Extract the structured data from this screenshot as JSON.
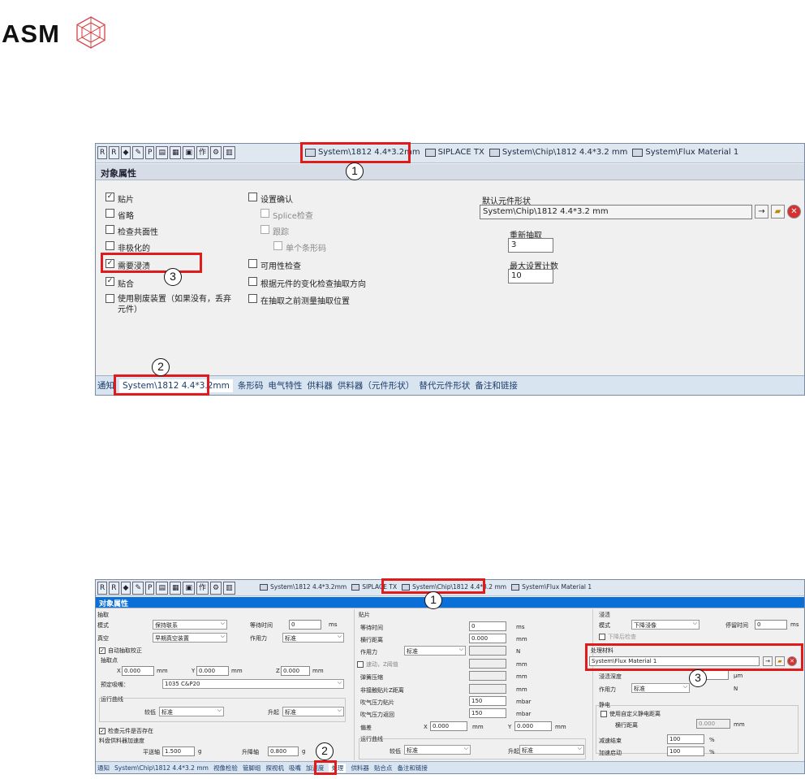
{
  "logo": {
    "text": "ASM"
  },
  "s1": {
    "toolbar_icons": [
      "R",
      "R",
      "",
      "",
      "P",
      "",
      "",
      "",
      "作",
      "",
      ""
    ],
    "tabs": [
      "System\\1812 4.4*3.2mm",
      "SIPLACE TX",
      "System\\Chip\\1812 4.4*3.2 mm",
      "System\\Flux Material 1"
    ],
    "header": "对象属性",
    "col1": [
      "贴片",
      "省略",
      "检查共面性",
      "非极化的",
      "需要浸渍",
      "贴合",
      "使用剔废装置（如果没有，丢弃元件）"
    ],
    "col1_checked": [
      true,
      false,
      false,
      false,
      true,
      true,
      false
    ],
    "col2": [
      "设置确认",
      "Splice检查",
      "跟踪",
      "单个条形码",
      "可用性检查",
      "根据元件的变化检查抽取方向",
      "在抽取之前测量抽取位置"
    ],
    "default_shape_label": "默认元件形状",
    "default_shape_value": "System\\Chip\\1812 4.4*3.2 mm",
    "repick_label": "重新抽取",
    "repick_value": "3",
    "max_count_label": "最大设置计数",
    "max_count_value": "10",
    "bottom_tabs": [
      "通知",
      "System\\1812 4.4*3.2mm",
      "条形码",
      "电气特性",
      "供料器",
      "供料器（元件形状）",
      "替代元件形状",
      "备注和链接"
    ]
  },
  "s2": {
    "toolbar_icons": [
      "R",
      "R",
      "",
      "",
      "P",
      "",
      "",
      "",
      "作",
      "",
      ""
    ],
    "tabs": [
      "System\\1812 4.4*3.2mm",
      "SIPLACE TX",
      "System\\Chip\\1812 4.4*3.2 mm",
      "System\\Flux Material 1"
    ],
    "header": "对象属性",
    "pick": {
      "title": "抽取",
      "mode_label": "模式",
      "mode_value": "保持联系",
      "wait_label": "等待时间",
      "wait_value": "0",
      "wait_unit": "ms",
      "vacuum_label": "真空",
      "vacuum_value": "早期真空装置",
      "force_label": "作用力",
      "force_value": "标准",
      "auto_label": "自动抽取校正",
      "point_label": "抽取点",
      "x_label": "X",
      "x_value": "0.000",
      "y_label": "Y",
      "y_value": "0.000",
      "z_label": "Z",
      "z_value": "0.000",
      "mm": "mm",
      "nozzle_label": "预定吸嘴：",
      "nozzle_value": "1035 C&P20",
      "curve_label": "运行曲线",
      "lower_label": "较低",
      "lower_value": "标准",
      "raise_label": "升起",
      "raise_value": "标准",
      "check_label": "检查元件是否存在",
      "accel_label": "料盘供料器加速度",
      "flat_label": "平送轴",
      "flat_value": "1.500",
      "g": "g",
      "lift_label": "升降轴",
      "lift_value": "0.800"
    },
    "place": {
      "title": "贴片",
      "wait_label": "等待时间",
      "wait_value": "0",
      "wait_unit": "ms",
      "dist_label": "横行距离",
      "dist_value": "0.000",
      "mm": "mm",
      "force_label": "作用力",
      "force_value": "标准",
      "n": "N",
      "speed_label": "速动，Z阈值",
      "spring_label": "弹簧压缩",
      "z_label": "非接触贴片Z距离",
      "blow1_label": "吹气压力贴片",
      "blow1_value": "150",
      "mbar": "mbar",
      "blow2_label": "吹气压力返回",
      "blow2_value": "150",
      "offset_label": "偏差",
      "x_label": "X",
      "x_value": "0.000",
      "y_label": "Y",
      "y_value": "0.000",
      "curve_label": "运行曲线",
      "lower_label": "较低",
      "lower_value": "标准",
      "raise_label": "升起",
      "raise_value": "标准"
    },
    "dip": {
      "title": "浸渍",
      "mode_label": "模式",
      "mode_value": "下降浸像",
      "dwell_label": "停留时间",
      "dwell_value": "0",
      "ms": "ms",
      "check_label": "下降后检查",
      "mat_label": "处理材料",
      "mat_value": "System\\Flux Material 1",
      "depth_label": "浸渍深度",
      "um": "μm",
      "force_label": "作用力",
      "force_value": "标准",
      "n": "N"
    },
    "static": {
      "title": "静电",
      "custom_label": "使用自定义静电距离",
      "dist_label": "横行距离",
      "dist_value": "0.000",
      "mm": "mm",
      "dec_label": "减速结束",
      "dec_value": "100",
      "pct": "%",
      "acc_label": "加速启动",
      "acc_value": "100"
    },
    "bottom_tabs": [
      "通知",
      "System\\Chip\\1812 4.4*3.2 mm",
      "视像检验",
      "管脚组",
      "探视机",
      "吸嘴",
      "加速度",
      "处理",
      "供料器",
      "贴合点",
      "备注和链接"
    ]
  },
  "callouts": [
    "1",
    "2",
    "3"
  ],
  "colors": {
    "highlight": "#e01b1b",
    "tabbar": "#dfe7f1",
    "blue_header": "#0a6fd6"
  }
}
